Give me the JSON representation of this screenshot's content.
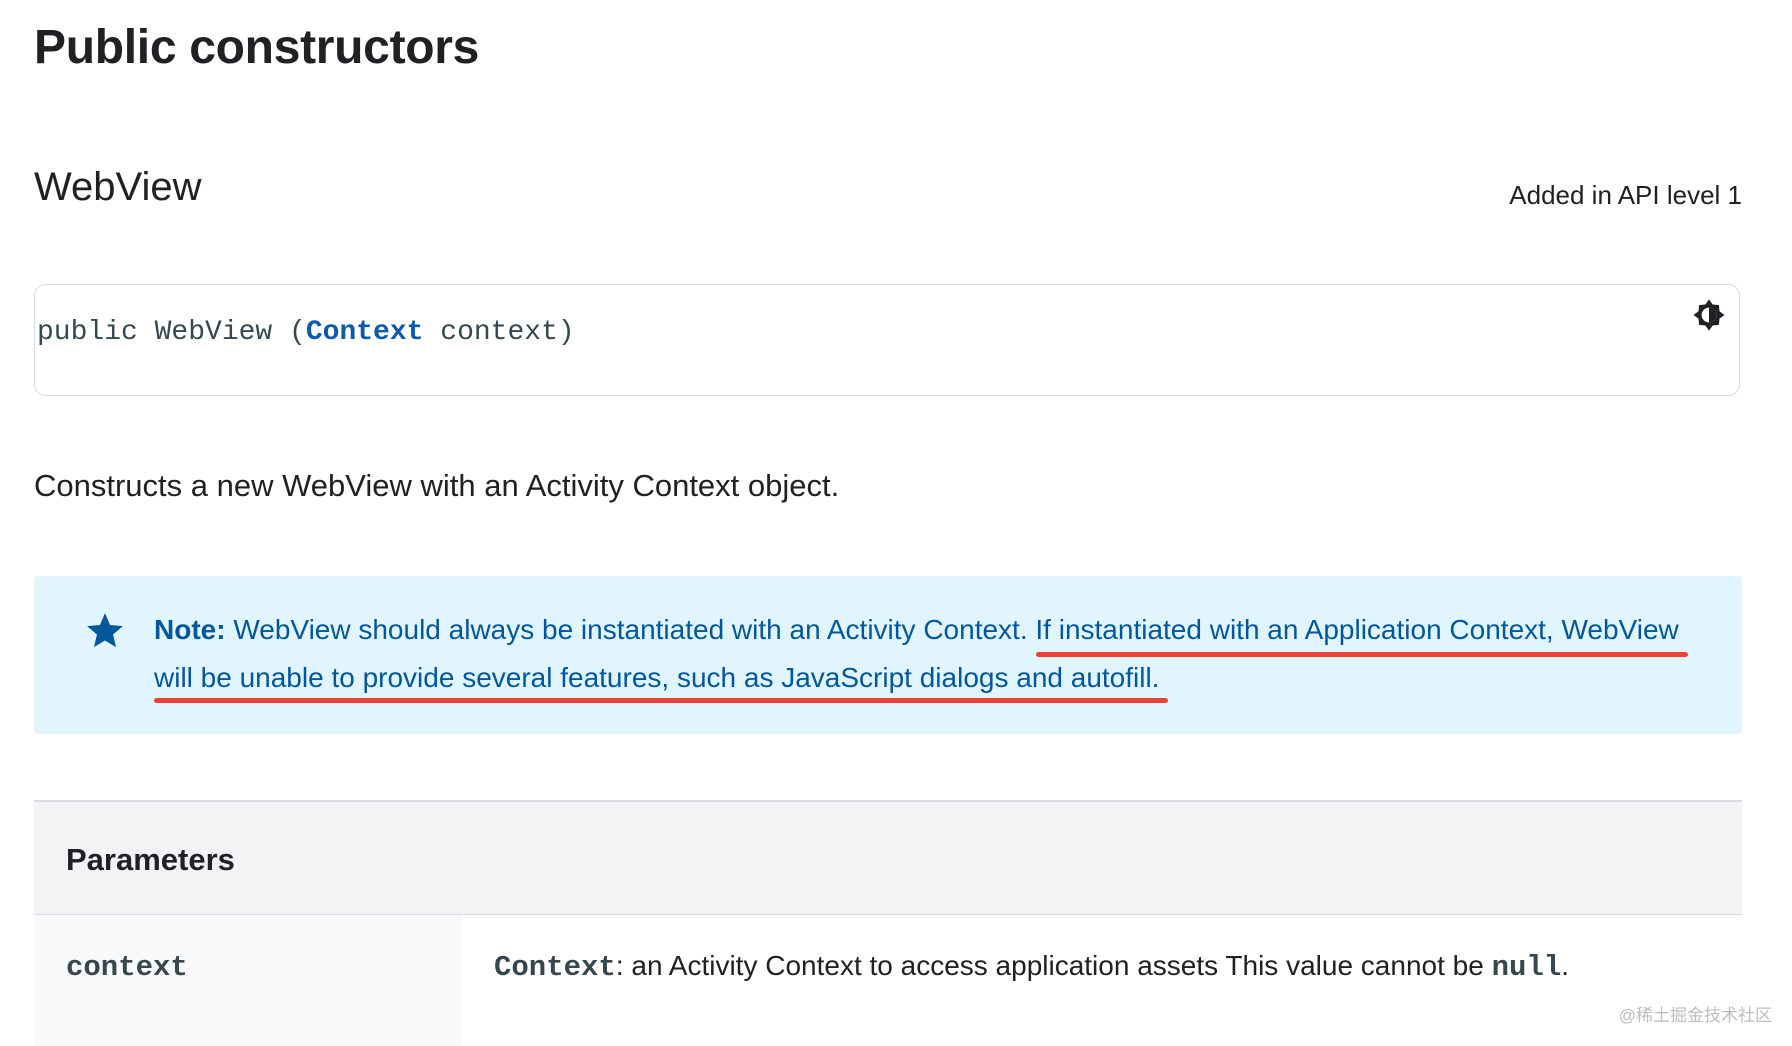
{
  "section_title": "Public constructors",
  "constructor": {
    "name": "WebView",
    "api_level": "Added in API level 1",
    "code": {
      "prefix": "public WebView (",
      "type": "Context",
      "suffix": " context)"
    },
    "description": "Constructs a new WebView with an Activity Context object."
  },
  "note": {
    "label": "Note:",
    "text_plain": " WebView should always be instantiated with an Activity Context. ",
    "text_line1_emph": "If instantiated with an Application Context, WebView",
    "text_line2_emph": "will be unable to provide several features, such as JavaScript dialogs and autofill.",
    "accent": "#01579b",
    "background": "#e1f5fe",
    "annotation_color": "#ea4335"
  },
  "parameters": {
    "title": "Parameters",
    "rows": [
      {
        "name": "context",
        "desc_type": "Context",
        "desc_text": ": an Activity Context to access application assets This value cannot be ",
        "desc_null": "null",
        "desc_end": "."
      }
    ]
  },
  "watermark": "@稀土掘金技术社区"
}
